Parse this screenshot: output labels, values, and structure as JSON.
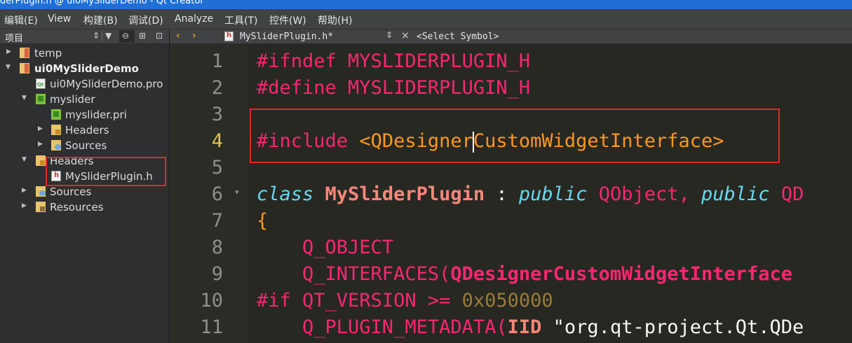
{
  "window": {
    "title": "derPlugin.h @ ui0MySliderDemo - Qt Creator"
  },
  "menubar": {
    "items": [
      "编辑(E)",
      "View",
      "构建(B)",
      "调试(D)",
      "Analyze",
      "工具(T)",
      "控件(W)",
      "帮助(H)"
    ]
  },
  "sidebar": {
    "title": "项目",
    "tree": [
      {
        "label": "temp",
        "icon": "project-folder-icon",
        "expanded": false
      },
      {
        "label": "ui0MySliderDemo",
        "icon": "project-folder-icon",
        "expanded": true,
        "bold": true
      },
      {
        "label": "ui0MySliderDemo.pro",
        "icon": "qt-pro-file-icon"
      },
      {
        "label": "myslider",
        "icon": "pri-folder-icon",
        "expanded": true
      },
      {
        "label": "myslider.pri",
        "icon": "pri-file-icon"
      },
      {
        "label": "Headers",
        "icon": "headers-folder-icon",
        "expanded": false
      },
      {
        "label": "Sources",
        "icon": "sources-folder-icon",
        "expanded": false
      },
      {
        "label": "Headers",
        "icon": "headers-folder-icon",
        "expanded": true
      },
      {
        "label": "MySliderPlugin.h",
        "icon": "header-file-icon"
      },
      {
        "label": "Sources",
        "icon": "sources-folder-icon",
        "expanded": false
      },
      {
        "label": "Resources",
        "icon": "resources-folder-icon",
        "expanded": false
      }
    ]
  },
  "editor": {
    "file_tab": "MySliderPlugin.h*",
    "symbol_placeholder": "<Select Symbol>",
    "current_line": 4,
    "line_numbers": [
      "1",
      "2",
      "3",
      "4",
      "5",
      "6",
      "7",
      "8",
      "9",
      "10",
      "11"
    ],
    "lines": {
      "l1": [
        "#ifndef",
        " MYSLIDERPLUGIN_H"
      ],
      "l2": [
        "#define",
        " MYSLIDERPLUGIN_H"
      ],
      "l4": [
        "#include",
        " ",
        "<QDesigner",
        "CustomWidgetInterface>"
      ],
      "l6": [
        "class",
        " ",
        "MySliderPlugin",
        " : ",
        "public",
        " QObject, ",
        "public",
        " QD"
      ],
      "l7": [
        "{"
      ],
      "l8": [
        "    Q_OBJECT"
      ],
      "l9": [
        "    Q_INTERFACES(",
        "QDesignerCustomWidgetInterface"
      ],
      "l10": [
        "#if",
        " QT_VERSION >= ",
        "0x050000"
      ],
      "l11": [
        "    Q_PLUGIN_METADATA(",
        "IID",
        " \"org.qt-project.Qt.QDe"
      ]
    }
  },
  "colors": {
    "accent_titlebar": "#1f6fd6",
    "annotation_box": "#e02828",
    "editor_bg": "#272822",
    "preprocessor": "#f92672",
    "keyword_type": "#66d9ef",
    "include_path": "#fd971f"
  }
}
